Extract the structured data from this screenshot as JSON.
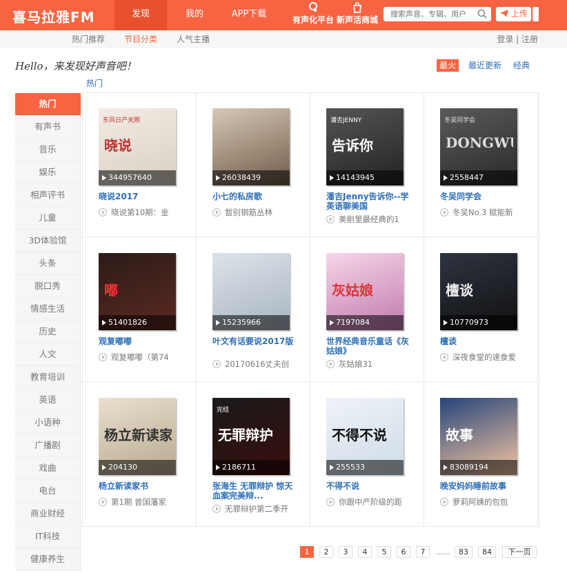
{
  "header": {
    "logo": "喜马拉雅FM",
    "nav": [
      "发现",
      "我的",
      "APP下载"
    ],
    "platform": "有声化平台",
    "mall": "新声活商城",
    "search_placeholder": "搜索声音、专辑、用户",
    "upload": "上传"
  },
  "subnav": {
    "items": [
      "热门推荐",
      "节目分类",
      "人气主播"
    ],
    "login": "登录 | 注册"
  },
  "greeting": "Hello，来发现好声音吧！",
  "hot_link": "热门",
  "sort": [
    "最火",
    "最近更新",
    "经典"
  ],
  "categories": [
    "热门",
    "有声书",
    "音乐",
    "娱乐",
    "相声评书",
    "儿童",
    "3D体验馆",
    "头条",
    "脱口秀",
    "情感生活",
    "历史",
    "人文",
    "教育培训",
    "英语",
    "小语种",
    "广播剧",
    "戏曲",
    "电台",
    "商业财经",
    "IT科技",
    "健康养生"
  ],
  "albums": [
    {
      "count": "344957640",
      "title": "晓说2017",
      "episode": "晓说第10期：金",
      "art_text": "晓说",
      "art_sub": "东风日产关照",
      "colors": [
        "#f3ece4",
        "#d9cfc3"
      ],
      "text_color": "#b33"
    },
    {
      "count": "26038439",
      "title": "小七的私房歌",
      "episode": "暂别钢筋丛林",
      "art_text": "",
      "art_sub": "",
      "colors": [
        "#d8c8b5",
        "#6e5a48"
      ],
      "text_color": "#fff"
    },
    {
      "count": "14143945",
      "title": "潘吉Jenny告诉你--学英语聊美国",
      "episode": "美剧里最经典的1",
      "art_text": "告诉你",
      "art_sub": "潘吉JENNY",
      "colors": [
        "#555",
        "#222"
      ],
      "text_color": "#fff"
    },
    {
      "count": "2558447",
      "title": "冬吴同学会",
      "episode": "冬吴No.3 赋能新",
      "art_text": "DONGWU",
      "art_sub": "冬吴同学会",
      "colors": [
        "#5a5a5a",
        "#2a2a2a"
      ],
      "text_color": "#ddd"
    },
    {
      "count": "51401826",
      "title": "观复嘟嘟",
      "episode": "观复嘟嘟（第74",
      "art_text": "嘟",
      "art_sub": "",
      "colors": [
        "#2b1b18",
        "#5d2a22"
      ],
      "text_color": "#e33"
    },
    {
      "count": "15235966",
      "title": "叶文有话要说2017版",
      "episode": "20170616丈夫创",
      "art_text": "",
      "art_sub": "",
      "colors": [
        "#dde3ea",
        "#a8b4c0"
      ],
      "text_color": "#fff"
    },
    {
      "count": "7197084",
      "title": "世界经典音乐童话《灰姑娘》",
      "episode": "灰姑娘31",
      "art_text": "灰姑娘",
      "art_sub": "",
      "colors": [
        "#f7d6e6",
        "#c07ab0"
      ],
      "text_color": "#d33"
    },
    {
      "count": "10770973",
      "title": "檀谈",
      "episode": "深夜食堂的速食爱",
      "art_text": "檀谈",
      "art_sub": "",
      "colors": [
        "#2e3440",
        "#111"
      ],
      "text_color": "#eee"
    },
    {
      "count": "204130",
      "title": "杨立新读家书",
      "episode": "第1期 曾国藩家",
      "art_text": "杨立新读家书",
      "art_sub": "",
      "colors": [
        "#e9e0cf",
        "#b8a98e"
      ],
      "text_color": "#333"
    },
    {
      "count": "2186711",
      "title": "张海生 无罪辩护 惊天血案完美辩...",
      "episode": "无罪辩护第二季开",
      "art_text": "无罪辩护",
      "art_sub": "完结",
      "colors": [
        "#1a1a1a",
        "#3a0e0e"
      ],
      "text_color": "#fff"
    },
    {
      "count": "255533",
      "title": "不得不说",
      "episode": "你跟中产阶级的距",
      "art_text": "不得不说",
      "art_sub": "",
      "colors": [
        "#eef3f8",
        "#cfdbe6"
      ],
      "text_color": "#111"
    },
    {
      "count": "83089194",
      "title": "晚安妈妈睡前故事",
      "episode": "萝莉阿姨的包包",
      "art_text": "故事",
      "art_sub": "",
      "colors": [
        "#26457a",
        "#f5c6a0"
      ],
      "text_color": "#fff"
    }
  ],
  "pagination": [
    "1",
    "2",
    "3",
    "4",
    "5",
    "6",
    "7",
    "......",
    "83",
    "84",
    "下一页"
  ]
}
